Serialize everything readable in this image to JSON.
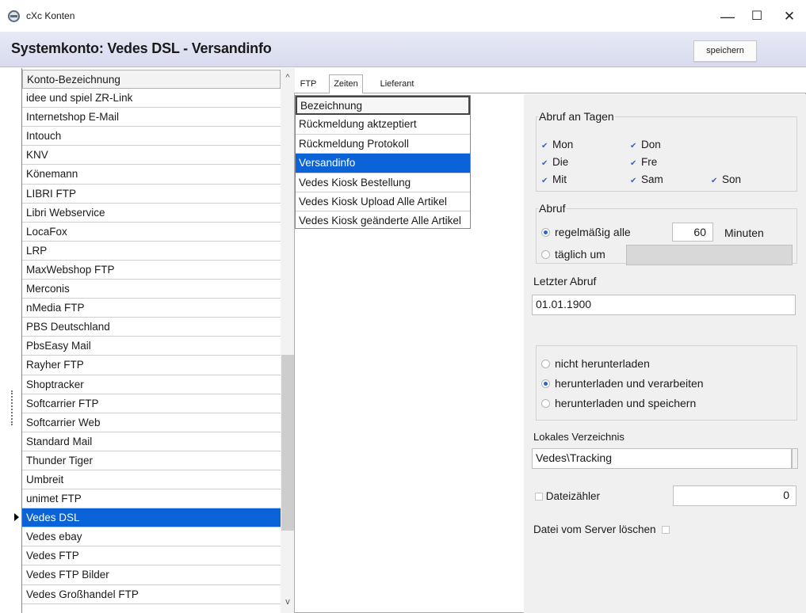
{
  "window": {
    "title": "cXc Konten",
    "minimize": "—",
    "maximize": "☐",
    "close": "✕"
  },
  "header": {
    "title": "Systemkonto: Vedes DSL - Versandinfo",
    "save_label": "speichern"
  },
  "accounts": {
    "column_header": "Konto-Bezeichnung",
    "items": [
      "idee und spiel ZR-Link",
      "Internetshop E-Mail",
      "Intouch",
      "KNV",
      "Könemann",
      "LIBRI FTP",
      "Libri Webservice",
      "LocaFox",
      "LRP",
      "MaxWebshop FTP",
      "Merconis",
      "nMedia FTP",
      "PBS Deutschland",
      "PbsEasy Mail",
      "Rayher FTP",
      "Shoptracker",
      "Softcarrier FTP",
      "Softcarrier Web",
      "Standard Mail",
      "Thunder Tiger",
      "Umbreit",
      "unimet FTP",
      "Vedes DSL",
      "Vedes ebay",
      "Vedes FTP",
      "Vedes FTP Bilder",
      "Vedes Großhandel FTP"
    ],
    "selected": "Vedes DSL",
    "scroll_up": "^",
    "scroll_down": "v"
  },
  "tabs": {
    "ftp": "FTP",
    "zeiten": "Zeiten",
    "lieferant": "Lieferant",
    "active": "Zeiten"
  },
  "types": {
    "column_header": "Bezeichnung",
    "items": [
      "Rückmeldung aktzeptiert",
      "Rückmeldung Protokoll",
      "Versandinfo",
      "Vedes Kiosk Bestellung",
      "Vedes Kiosk Upload Alle Artikel",
      "Vedes Kiosk geänderte Alle Artikel"
    ],
    "selected": "Versandinfo"
  },
  "settings": {
    "days_legend": "Abruf an Tagen",
    "days": {
      "mon": "Mon",
      "don": "Don",
      "die": "Die",
      "fre": "Fre",
      "mit": "Mit",
      "sam": "Sam",
      "son": "Son"
    },
    "check_glyph": "✔",
    "abruf_legend": "Abruf",
    "regular_label": "regelmäßig alle",
    "interval_value": "60",
    "interval_unit": "Minuten",
    "daily_label": "täglich um",
    "daily_time": "",
    "last_fetch_label": "Letzter Abruf",
    "last_fetch_value": "01.01.1900",
    "mode_options": {
      "none": "nicht herunterladen",
      "process": "herunterladen und verarbeiten",
      "store": "herunterladen und speichern"
    },
    "local_dir_label": "Lokales Verzeichnis",
    "local_dir_value": "Vedes\\Tracking",
    "counter_label": "Dateizähler",
    "counter_value": "0",
    "delete_label": "Datei vom Server löschen"
  }
}
